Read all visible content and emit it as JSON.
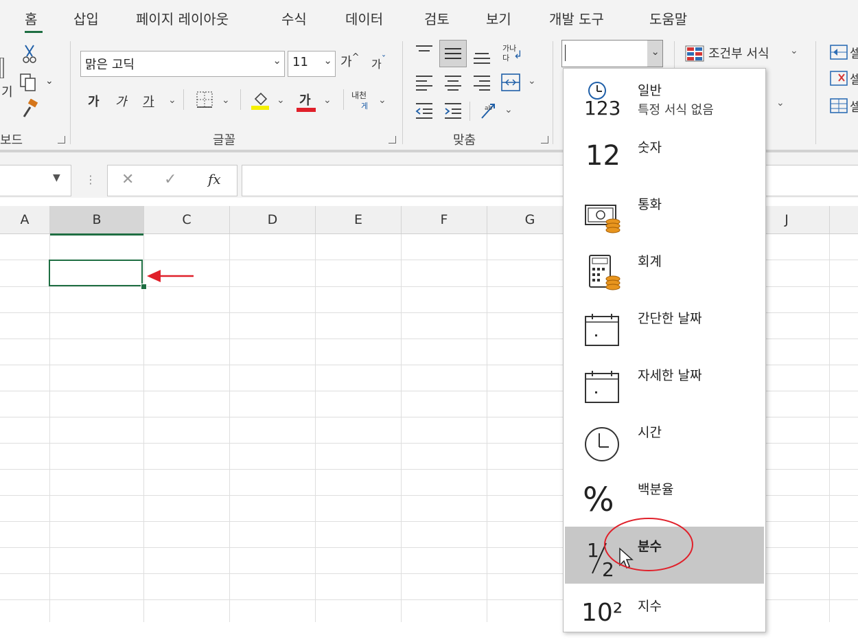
{
  "tabs": [
    "홈",
    "삽입",
    "페이지 레이아웃",
    "수식",
    "데이터",
    "검토",
    "보기",
    "개발 도구",
    "도움말"
  ],
  "ribbon": {
    "clipboard_partial_label": "보드",
    "clipboard_partial_text": "기",
    "font_name": "맑은 고딕",
    "font_size": "11",
    "grow_font": "가",
    "shrink_font": "가",
    "bold": "가",
    "italic": "가",
    "underline": "가",
    "font_color_letter": "가",
    "wrap_top": "가나",
    "wrap_bottom": "다",
    "phonetic_top": "내천",
    "phonetic_bottom": "게",
    "font_group_label": "글꼴",
    "align_group_label": "맞춤",
    "number_format_value": "",
    "conditional_format": "조건부 서식",
    "right_partial_1": "셀",
    "right_partial_2": "셀",
    "right_partial_3": "셀"
  },
  "formula_bar": {
    "name_box": "",
    "cancel": "✕",
    "enter": "✓",
    "fx": "fx",
    "formula": ""
  },
  "columns": [
    "A",
    "B",
    "C",
    "D",
    "E",
    "F",
    "G",
    "J"
  ],
  "selected_cell": "B2",
  "number_formats": [
    {
      "label": "일반",
      "sub": "특정 서식 없음",
      "icon": "general-format-icon",
      "icon_text": "123"
    },
    {
      "label": "숫자",
      "sub": "",
      "icon": "number-format-icon",
      "icon_text": "12"
    },
    {
      "label": "통화",
      "sub": "",
      "icon": "currency-format-icon",
      "icon_text": ""
    },
    {
      "label": "회계",
      "sub": "",
      "icon": "accounting-format-icon",
      "icon_text": ""
    },
    {
      "label": "간단한 날짜",
      "sub": "",
      "icon": "short-date-icon",
      "icon_text": ""
    },
    {
      "label": "자세한 날짜",
      "sub": "",
      "icon": "long-date-icon",
      "icon_text": ""
    },
    {
      "label": "시간",
      "sub": "",
      "icon": "time-format-icon",
      "icon_text": ""
    },
    {
      "label": "백분율",
      "sub": "",
      "icon": "percentage-format-icon",
      "icon_text": "%"
    },
    {
      "label": "분수",
      "sub": "",
      "icon": "fraction-format-icon",
      "icon_text": "½"
    },
    {
      "label": "지수",
      "sub": "",
      "icon": "scientific-format-icon",
      "icon_text": "10²"
    }
  ],
  "highlighted_item": "분수",
  "colors": {
    "accent_green": "#1e6e42",
    "annotation_red": "#e0202a",
    "coin_orange": "#e8951e",
    "highlight_gray": "#c7c7c7"
  }
}
